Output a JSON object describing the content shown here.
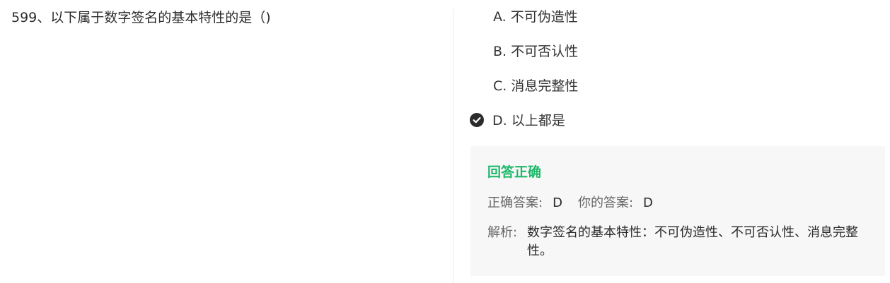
{
  "question": {
    "text": "599、以下属于数字签名的基本特性的是（)"
  },
  "options": [
    {
      "text": "A. 不可伪造性",
      "selected": false
    },
    {
      "text": "B. 不可否认性",
      "selected": false
    },
    {
      "text": "C. 消息完整性",
      "selected": false
    },
    {
      "text": "D. 以上都是",
      "selected": true
    }
  ],
  "result": {
    "title": "回答正确",
    "correct_label": "正确答案:",
    "correct_value": "D",
    "your_label": "你的答案:",
    "your_value": "D",
    "analysis_label": "解析:",
    "analysis_text": "数字签名的基本特性：不可伪造性、不可否认性、消息完整性。"
  },
  "colors": {
    "success": "#1fb96a",
    "panel_bg": "#f7f7f7",
    "check_bg": "#2b2b2b"
  },
  "icons": {
    "selected_mark": "check-circle-icon"
  }
}
